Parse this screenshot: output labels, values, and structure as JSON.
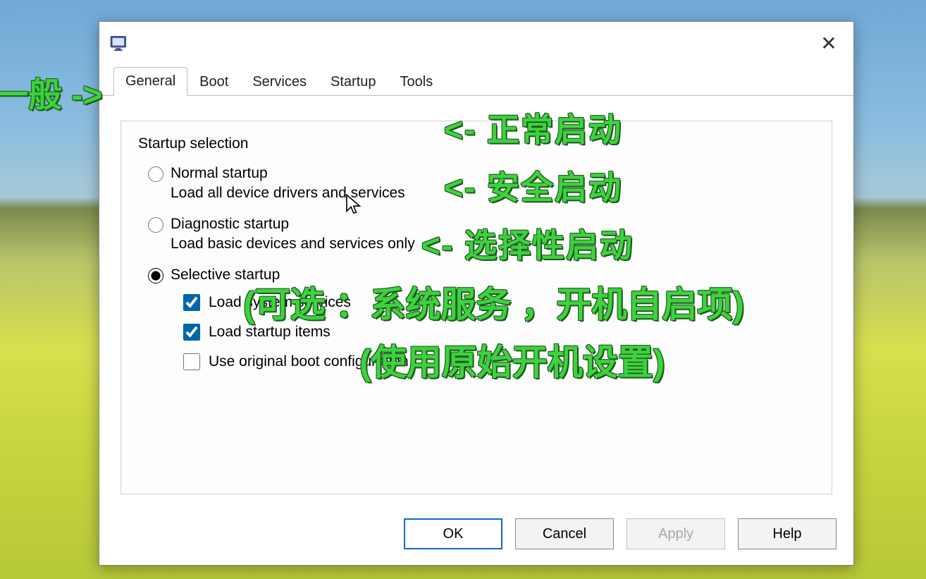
{
  "tabs": {
    "general": "General",
    "boot": "Boot",
    "services": "Services",
    "startup": "Startup",
    "tools": "Tools"
  },
  "group": {
    "title": "Startup selection",
    "normal": {
      "label": "Normal startup",
      "desc": "Load all device drivers and services",
      "checked": false
    },
    "diagnostic": {
      "label": "Diagnostic startup",
      "desc": "Load basic devices and services only",
      "checked": false
    },
    "selective": {
      "label": "Selective startup",
      "checked": true,
      "sys": {
        "label": "Load system services",
        "checked": true
      },
      "items": {
        "label": "Load startup items",
        "checked": true
      },
      "orig": {
        "label": "Use original boot configuration",
        "checked": false
      }
    }
  },
  "buttons": {
    "ok": "OK",
    "cancel": "Cancel",
    "apply": "Apply",
    "help": "Help"
  },
  "annotations": {
    "left": "一般 ->",
    "a1": "<- 正常启动",
    "a2": "<- 安全启动",
    "a3": "<- 选择性启动",
    "a4": "(可选 ：系统服务 ，开机自启项)",
    "a5": "(使用原始开机设置)"
  }
}
